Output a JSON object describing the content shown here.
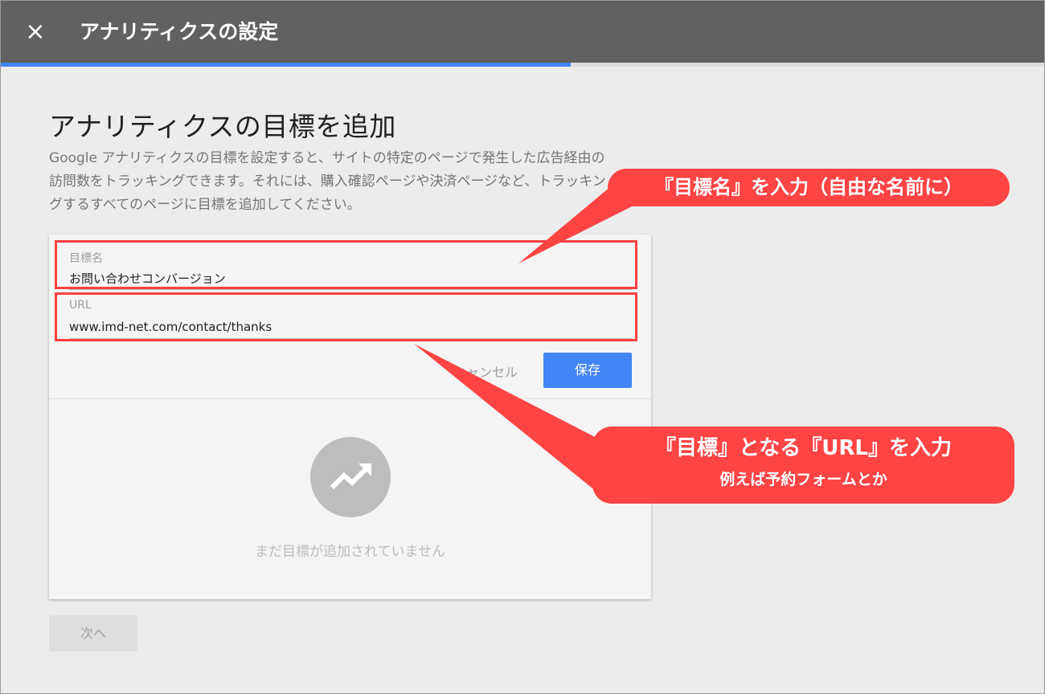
{
  "header": {
    "close_icon": "×",
    "title": "アナリティクスの設定",
    "progress_fraction": 0.546
  },
  "page": {
    "title": "アナリティクスの目標を追加",
    "description": [
      "Google アナリティクスの目標を設定すると、サイトの特定のページで発生した広告経由の",
      "訪問数をトラッキングできます。それには、購入確認ページや決済ページなど、トラッキン",
      "グするすべてのページに目標を追加してください。"
    ]
  },
  "form": {
    "goal_name_label": "目標名",
    "goal_name_value": "お問い合わせコンバージョン",
    "url_label": "URL",
    "url_value": "www.imd-net.com/contact/thanks",
    "cancel_label": "キャンセル",
    "save_label": "保存"
  },
  "empty_state": {
    "icon": "trending-up-icon",
    "message": "まだ目標が追加されていません"
  },
  "footer": {
    "next_label": "次へ"
  },
  "annotations": {
    "callout1": "『目標名』を入力（自由な名前に）",
    "callout2_line1": "『目標』となる『URL』を入力",
    "callout2_line2": "例えば予約フォームとか"
  },
  "colors": {
    "topbar": "#616161",
    "accent": "#4285f4",
    "annotation": "#ff4444"
  }
}
